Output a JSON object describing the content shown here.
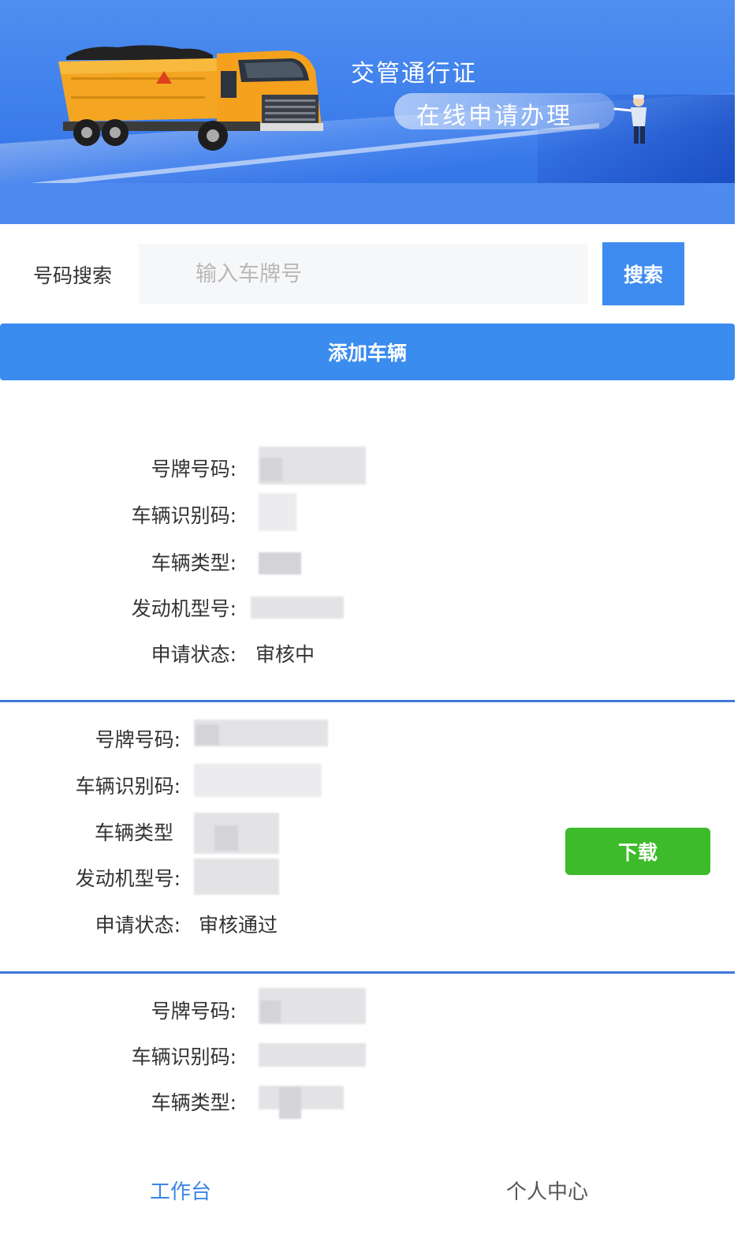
{
  "banner": {
    "title": "交管通行证",
    "subtitle": "在线申请办理"
  },
  "search": {
    "label": "号码搜索",
    "placeholder": "输入车牌号",
    "button_label": "搜索"
  },
  "add_vehicle_label": "添加车辆",
  "labels": {
    "plate": "号牌号码:",
    "vin": "车辆识别码:",
    "type": "车辆类型:",
    "type_nocolon": "车辆类型",
    "engine": "发动机型号:",
    "status": "申请状态:"
  },
  "vehicles": [
    {
      "status": "审核中"
    },
    {
      "status": "审核通过",
      "download_label": "下载"
    },
    {}
  ],
  "tabbar": {
    "workbench": "工作台",
    "profile": "个人中心"
  },
  "colors": {
    "primary": "#3a8cef",
    "download": "#3dbb2a",
    "divider": "#3f79dc"
  }
}
